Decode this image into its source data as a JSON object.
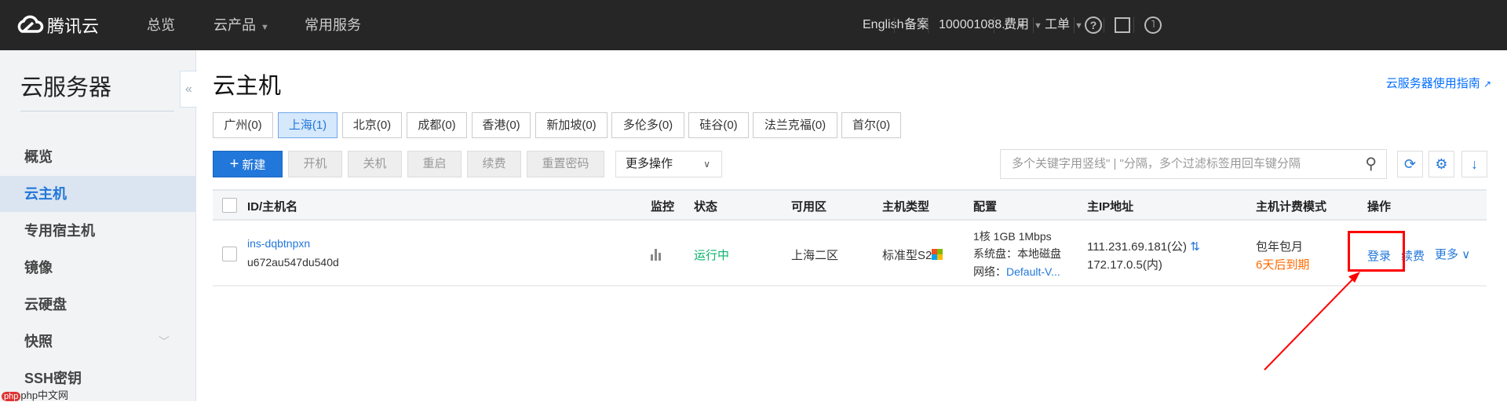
{
  "header": {
    "logo": "腾讯云",
    "nav": [
      "总览",
      "云产品",
      "常用服务"
    ],
    "right": {
      "language": "English",
      "filing": "备案",
      "account": "100001088...",
      "billing": "费用",
      "ticket": "工单"
    }
  },
  "sidebar": {
    "title": "云服务器",
    "items": [
      "概览",
      "云主机",
      "专用宿主机",
      "镜像",
      "云硬盘",
      "快照",
      "SSH密钥"
    ],
    "active": "云主机"
  },
  "page": {
    "title": "云主机",
    "guide_link": "云服务器使用指南"
  },
  "regions": [
    "广州(0)",
    "上海(1)",
    "北京(0)",
    "成都(0)",
    "香港(0)",
    "新加坡(0)",
    "多伦多(0)",
    "硅谷(0)",
    "法兰克福(0)",
    "首尔(0)"
  ],
  "active_region": "上海(1)",
  "toolbar": {
    "new": "新建",
    "start": "开机",
    "stop": "关机",
    "restart": "重启",
    "renew": "续费",
    "reset_password": "重置密码",
    "more": "更多操作",
    "search_placeholder": "多个关键字用竖线\" | \"分隔，多个过滤标签用回车键分隔"
  },
  "table": {
    "headers": [
      "ID/主机名",
      "监控",
      "状态",
      "可用区",
      "主机类型",
      "配置",
      "主IP地址",
      "主机计费模式",
      "操作"
    ],
    "rows": [
      {
        "id": "ins-dqbtnpxn",
        "name": "u672au547du540d",
        "status": "运行中",
        "zone": "上海二区",
        "type": "标准型S2",
        "config": [
          "1核 1GB 1Mbps",
          "系统盘：本地磁盘",
          "网络："
        ],
        "network": "Default-V...",
        "ip_public": "111.231.69.181(公)",
        "ip_private": "172.17.0.5(内)",
        "billing": "包年包月",
        "expiry": "6天后到期",
        "actions": [
          "登录",
          "续费",
          "更多"
        ]
      }
    ]
  },
  "watermark": "php中文网",
  "colors": {
    "accent": "#2277da",
    "running": "#09b36b",
    "warning": "#ff6a00",
    "annotation": "#ff0000"
  }
}
